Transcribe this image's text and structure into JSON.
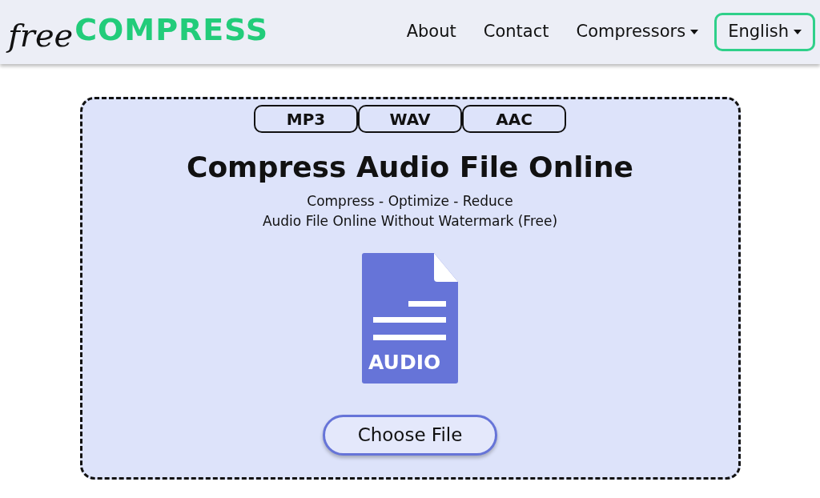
{
  "header": {
    "logo": {
      "prefix": "free",
      "name": "COMPRESS"
    },
    "nav": [
      {
        "label": "About",
        "kind": "link"
      },
      {
        "label": "Contact",
        "kind": "link"
      },
      {
        "label": "Compressors",
        "kind": "dropdown"
      }
    ],
    "language": {
      "label": "English"
    }
  },
  "card": {
    "formats": [
      {
        "label": "MP3"
      },
      {
        "label": "WAV"
      },
      {
        "label": "AAC"
      }
    ],
    "title": "Compress Audio File Online",
    "subtitle_lines": [
      "Compress - Optimize - Reduce",
      "Audio File Online Without Watermark (Free)"
    ],
    "file_type": "AUDIO",
    "button": "Choose File"
  }
}
